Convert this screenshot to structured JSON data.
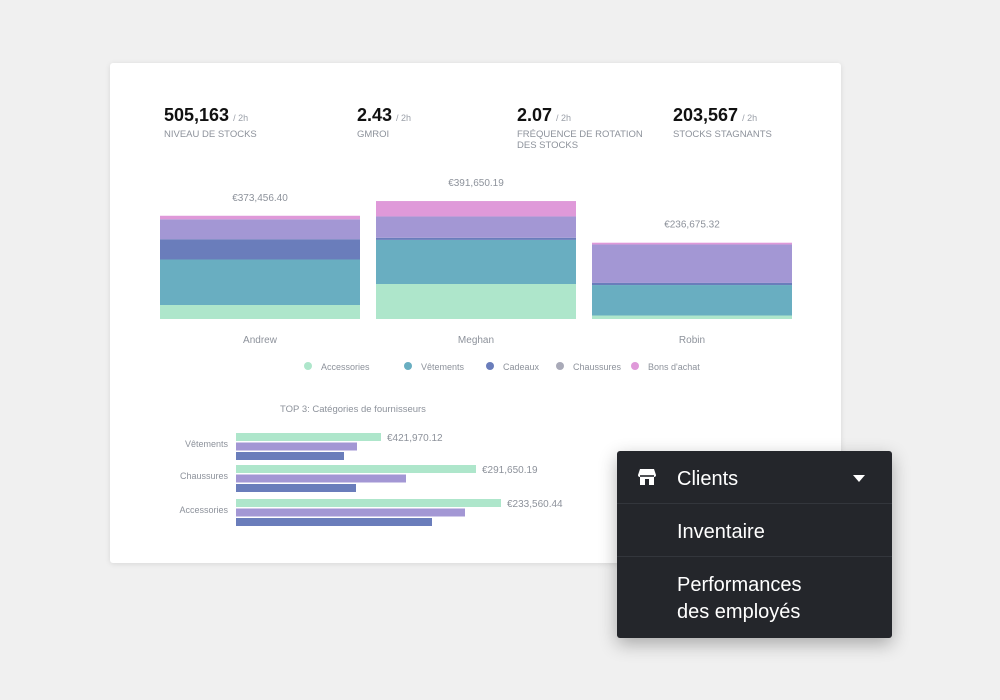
{
  "kpis": [
    {
      "value": "505,163",
      "period": "/ 2h",
      "label": "NIVEAU DE STOCKS"
    },
    {
      "value": "2.43",
      "period": "/ 2h",
      "label": "GMROI"
    },
    {
      "value": "2.07",
      "period": "/ 2h",
      "label": "FRÉQUENCE DE ROTATION DES STOCKS"
    },
    {
      "value": "203,567",
      "period": "/ 2h",
      "label": "STOCKS STAGNANTS"
    }
  ],
  "colors": {
    "accessories": "#aee6cb",
    "vetements": "#69aec1",
    "cadeaux": "#6a7dbb",
    "chaussures": "#a397d4",
    "bons": "#df99d9"
  },
  "chart_data": [
    {
      "type": "bar",
      "stacked": true,
      "categories": [
        "Andrew",
        "Meghan",
        "Robin"
      ],
      "totals_labels": [
        "€373,456.40",
        "€391,650.19",
        "€236,675.32"
      ],
      "ylim": [
        0,
        400000
      ],
      "series": [
        {
          "name": "Accessories",
          "values": [
            40000,
            100000,
            10000
          ]
        },
        {
          "name": "Vêtements",
          "values": [
            130000,
            126000,
            87000
          ]
        },
        {
          "name": "Cadeaux",
          "values": [
            58000,
            6000,
            6000
          ]
        },
        {
          "name": "Chaussures",
          "values": [
            57000,
            61000,
            110000
          ]
        },
        {
          "name": "Bons d'achat",
          "values": [
            10000,
            44000,
            5000
          ]
        }
      ],
      "legend": [
        "Accessories",
        "Vêtements",
        "Cadeaux",
        "Chaussures",
        "Bons d'achat"
      ],
      "legend_position": "bottom"
    },
    {
      "type": "bar",
      "orientation": "horizontal",
      "title": "TOP 3: Catégories de fournisseurs",
      "categories": [
        "Vêtements",
        "Chaussures",
        "Accessories"
      ],
      "value_labels": [
        "€421,970.12",
        "€291,650.19",
        "€233,560.44"
      ],
      "xlim": [
        0,
        280
      ],
      "series": [
        {
          "values": [
            145,
            240,
            265
          ]
        },
        {
          "values": [
            121,
            170,
            229
          ]
        },
        {
          "values": [
            108,
            120,
            196
          ]
        }
      ]
    }
  ],
  "menu": {
    "items": [
      {
        "label": "Clients",
        "icon": "store-icon",
        "has_dropdown": true
      },
      {
        "label": "Inventaire"
      },
      {
        "label_lines": [
          "Performances",
          "des employés"
        ]
      }
    ]
  }
}
